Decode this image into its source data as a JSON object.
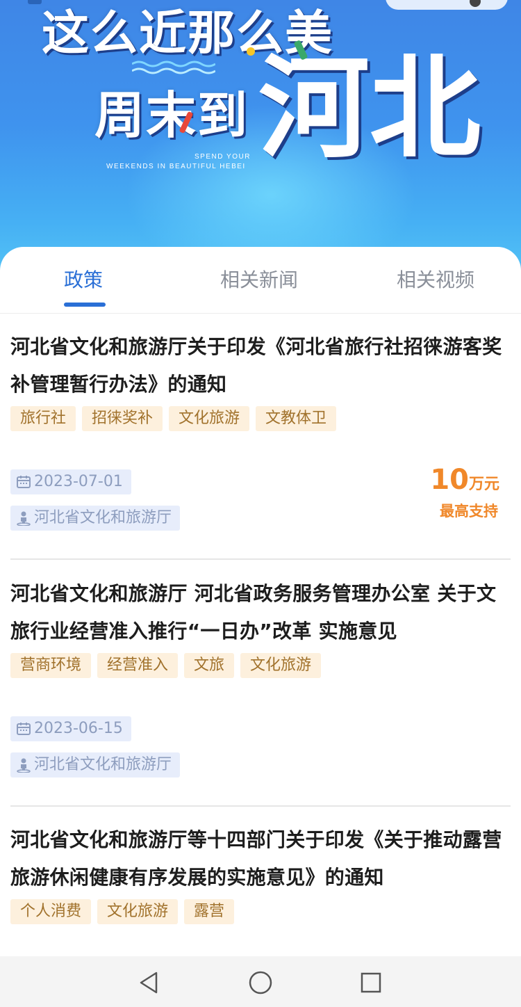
{
  "hero": {
    "line1": "这么近那么美",
    "line2": "周末到",
    "big_text": "河北",
    "english_line1": "SPEND YOUR",
    "english_line2": "WEEKENDS IN BEAUTIFUL HEBEI"
  },
  "tabs": [
    {
      "label": "政策",
      "active": true
    },
    {
      "label": "相关新闻",
      "active": false
    },
    {
      "label": "相关视频",
      "active": false
    }
  ],
  "articles": [
    {
      "title": "河北省文化和旅游厅关于印发《河北省旅行社招徕游客奖补管理暂行办法》的通知",
      "tags": [
        "旅行社",
        "招徕奖补",
        "文化旅游",
        "文教体卫"
      ],
      "date": "2023-07-01",
      "department": "河北省文化和旅游厅",
      "support_amount": "10",
      "support_unit": "万元",
      "support_label": "最高支持"
    },
    {
      "title": "河北省文化和旅游厅 河北省政务服务管理办公室 关于文旅行业经营准入推行“一日办”改革 实施意见",
      "tags": [
        "营商环境",
        "经营准入",
        "文旅",
        "文化旅游"
      ],
      "date": "2023-06-15",
      "department": "河北省文化和旅游厅"
    },
    {
      "title": "河北省文化和旅游厅等十四部门关于印发《关于推动露营旅游休闲健康有序发展的实施意见》的通知",
      "tags": [
        "个人消费",
        "文化旅游",
        "露营"
      ]
    }
  ],
  "icons": {
    "date": "calendar-icon",
    "department": "person-location-icon",
    "nav_back": "triangle-back-icon",
    "nav_home": "circle-home-icon",
    "nav_recent": "square-recent-icon"
  },
  "colors": {
    "accent": "#2a6fd6",
    "tag_bg": "#fdf0dd",
    "tag_text": "#a1722c",
    "support": "#f0882a",
    "meta_bg": "#e7edfb"
  }
}
